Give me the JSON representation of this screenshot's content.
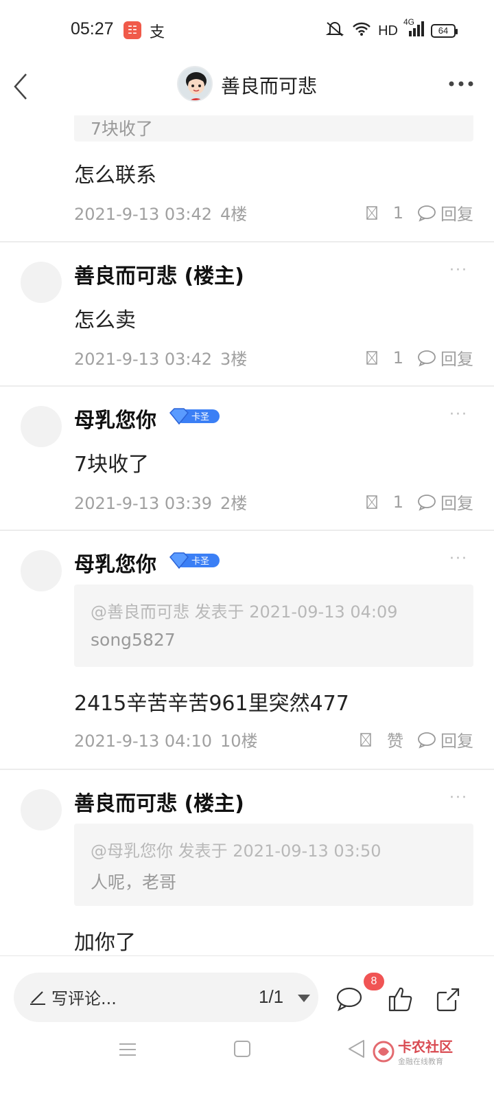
{
  "status_bar": {
    "time": "05:27",
    "app_icon_1": "app-notification-icon",
    "app_icon_2": "支",
    "network": "HD",
    "signal": "4G",
    "battery": "64"
  },
  "header": {
    "title": "善良而可悲",
    "back_icon": "chevron-left-icon",
    "more_icon": "more-horizontal-icon"
  },
  "top_partial": {
    "quote_text": "7块收了",
    "text": "怎么联系",
    "time": "2021-9-13 03:42",
    "floor": "4楼",
    "likes": "1",
    "reply": "回复"
  },
  "floors": [
    {
      "user": "善良而可悲 (楼主)",
      "text": "怎么卖",
      "time": "2021-9-13 03:42",
      "floor": "3楼",
      "likes": "1",
      "reply": "回复"
    },
    {
      "user": "母乳您你",
      "badge": "卡圣",
      "text": "7块收了",
      "time": "2021-9-13 03:39",
      "floor": "2楼",
      "likes": "1",
      "reply": "回复"
    },
    {
      "user": "母乳您你",
      "badge": "卡圣",
      "quote_head": "@善良而可悲 发表于 2021-09-13 04:09",
      "quote_body": "song5827",
      "text": "2415辛苦辛苦961里突然477",
      "time": "2021-9-13 04:10",
      "floor": "10楼",
      "likes": "赞",
      "reply": "回复"
    },
    {
      "user": "善良而可悲 (楼主)",
      "quote_head": "@母乳您你 发表于 2021-09-13 03:50",
      "quote_body": "人呢，老哥",
      "text": "加你了"
    }
  ],
  "more_dots": "···",
  "bottom_bar": {
    "placeholder": "写评论...",
    "page": "1/1",
    "comment_count": "8"
  },
  "watermark": {
    "name": "卡农社区",
    "sub": "金融在线教育"
  },
  "colors": {
    "badge_blue": "#3b7ff5",
    "red": "#f05454",
    "text_gray": "#a0a0a0"
  }
}
